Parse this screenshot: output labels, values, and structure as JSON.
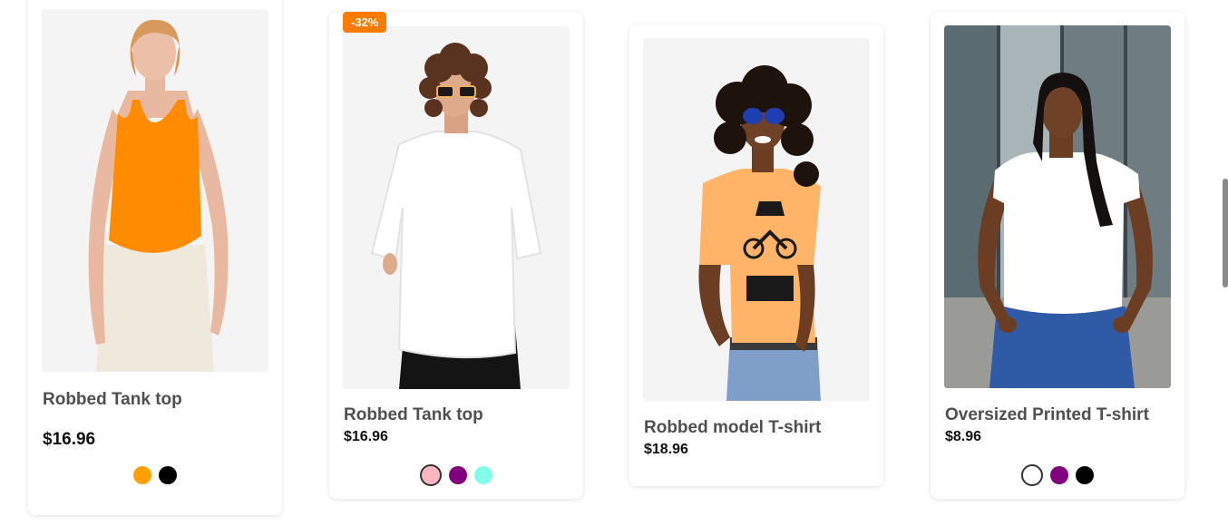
{
  "products": [
    {
      "title": "Robbed Tank top",
      "price": "$16.96",
      "swatches": [
        {
          "color": "#ff9f00",
          "selected": false
        },
        {
          "color": "#000000",
          "selected": false
        }
      ]
    },
    {
      "badge": "-32%",
      "title": "Robbed Tank top",
      "price": "$16.96",
      "swatches": [
        {
          "color": "#ffb6c1",
          "selected": true
        },
        {
          "color": "#800080",
          "selected": false
        },
        {
          "color": "#7fffe8",
          "selected": false
        }
      ]
    },
    {
      "title": "Robbed model T-shirt",
      "price": "$18.96",
      "swatches": []
    },
    {
      "title": "Oversized Printed T-shirt",
      "price": "$8.96",
      "swatches": [
        {
          "color": "#ffffff",
          "selected": true
        },
        {
          "color": "#800080",
          "selected": false
        },
        {
          "color": "#000000",
          "selected": false
        }
      ]
    }
  ],
  "colors": {
    "badge": "#ff7b00",
    "title": "#4f4f4f",
    "price": "#111111"
  }
}
